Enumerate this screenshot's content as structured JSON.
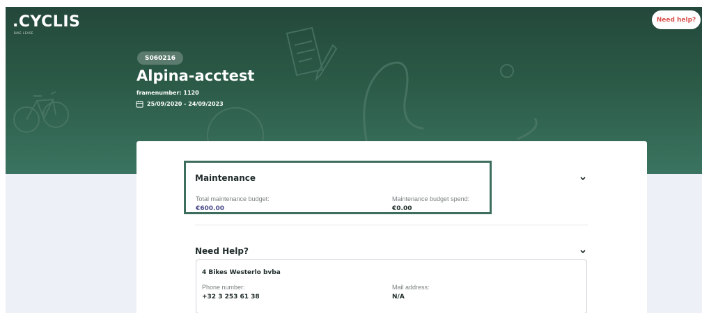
{
  "brand": {
    "logo": ".CYCLIS",
    "sub": "BIKE LEASE"
  },
  "header": {
    "help_button": "Need help?",
    "order_tag": "S060216",
    "title": "Alpina-acctest",
    "frame_number": "framenumber: 1120",
    "period": "25/09/2020 - 24/09/2023"
  },
  "maintenance": {
    "title": "Maintenance",
    "total_label": "Total maintenance budget:",
    "total_value": "€600.00",
    "spend_label": "Maintenance budget spend:",
    "spend_value": "€0.00"
  },
  "need_help": {
    "title": "Need Help?",
    "dealer_name": "4 Bikes Westerlo bvba",
    "phone_label": "Phone number:",
    "phone_value": "+32 3 253 61 38",
    "mail_label": "Mail address:",
    "mail_value": "N/A"
  },
  "colors": {
    "hero": "#2b5a47",
    "accent_link": "#4a4a8a",
    "help_text": "#d9534f",
    "highlight_border": "#3d6e5d"
  },
  "icons": [
    "calendar-icon",
    "chevron-down-icon",
    "bike-illustration",
    "document-illustration"
  ]
}
